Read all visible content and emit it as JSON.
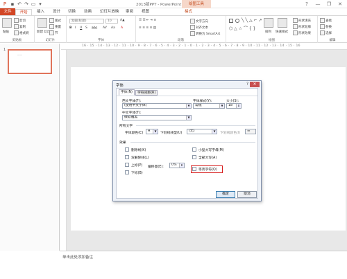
{
  "titlebar": {
    "title": "2013版PPT - PowerPoint",
    "context_tools": "绘图工具",
    "window_controls": [
      "?",
      "—",
      "❐",
      "✕"
    ]
  },
  "tabs": [
    "文件",
    "开始",
    "插入",
    "设计",
    "切换",
    "动画",
    "幻灯片放映",
    "审阅",
    "视图",
    "格式"
  ],
  "ribbon": {
    "clipboard": {
      "paste": "粘贴",
      "cut": "剪切",
      "copy": "复制",
      "format_painter": "格式刷",
      "label": "剪贴板"
    },
    "slides": {
      "new_slide": "新建\n幻灯片",
      "layout": "版式",
      "reset": "重置",
      "section": "节",
      "label": "幻灯片"
    },
    "font": {
      "font_name": "幼圆(标题)",
      "font_size": "10",
      "label": "字体"
    },
    "paragraph": {
      "text_direction": "文字方向",
      "align_text": "对齐文本",
      "smartart": "转换为 SmartArt",
      "label": "段落"
    },
    "drawing": {
      "arrange": "排列",
      "quick_styles": "快速样式",
      "shape_fill": "形状填充",
      "shape_outline": "形状轮廓",
      "shape_effects": "形状效果",
      "label": "绘图"
    },
    "editing": {
      "find": "查找",
      "replace": "替换",
      "select": "选择",
      "label": "编辑"
    }
  },
  "ruler": {
    "text": "16 · 15 · 14 · 13 · 12 · 11 · 10 · 9 · 8 · 7 · 6 · 5 · 4 · 3 · 2 · 1 · 0 · 1 · 2 · 3 · 4 · 5 · 6 · 7 · 8 · 9 · 10 · 11 · 12 · 13 · 14 · 15 · 16"
  },
  "thumbnails": {
    "slide_number": "1",
    "thumb_text": "——"
  },
  "notes": {
    "placeholder": "单击此处添加备注"
  },
  "dialog": {
    "title": "字体",
    "help": "?",
    "close": "✕",
    "tabs": [
      "字体(N)",
      "字符间距(R)"
    ],
    "latin_font_label": "西文字体(F):",
    "latin_font_value": "(使用中文字体)",
    "style_label": "字体样式(Y):",
    "style_value": "常规",
    "size_label": "大小(S):",
    "size_value": "18",
    "asian_font_label": "中文字体(T):",
    "asian_font_value": "微软雅黑",
    "all_text_label": "所有文字",
    "font_color_label": "字体颜色(C)",
    "underline_style_label": "下划线线型(U)",
    "underline_style_value": "(无)",
    "underline_color_label": "下划线颜色(I)",
    "effects_label": "效果",
    "effects": {
      "strikethrough": "删除线(K)",
      "double_strike": "双删除线(L)",
      "superscript": "上标(P)",
      "subscript": "下标(B)",
      "offset_label": "偏移量(E):",
      "offset_value": "0%",
      "small_caps": "小型大写字母(M)",
      "all_caps": "全部大写(A)",
      "equalize_height": "等高字符(Q)"
    },
    "ok": "确定",
    "cancel": "取消"
  }
}
